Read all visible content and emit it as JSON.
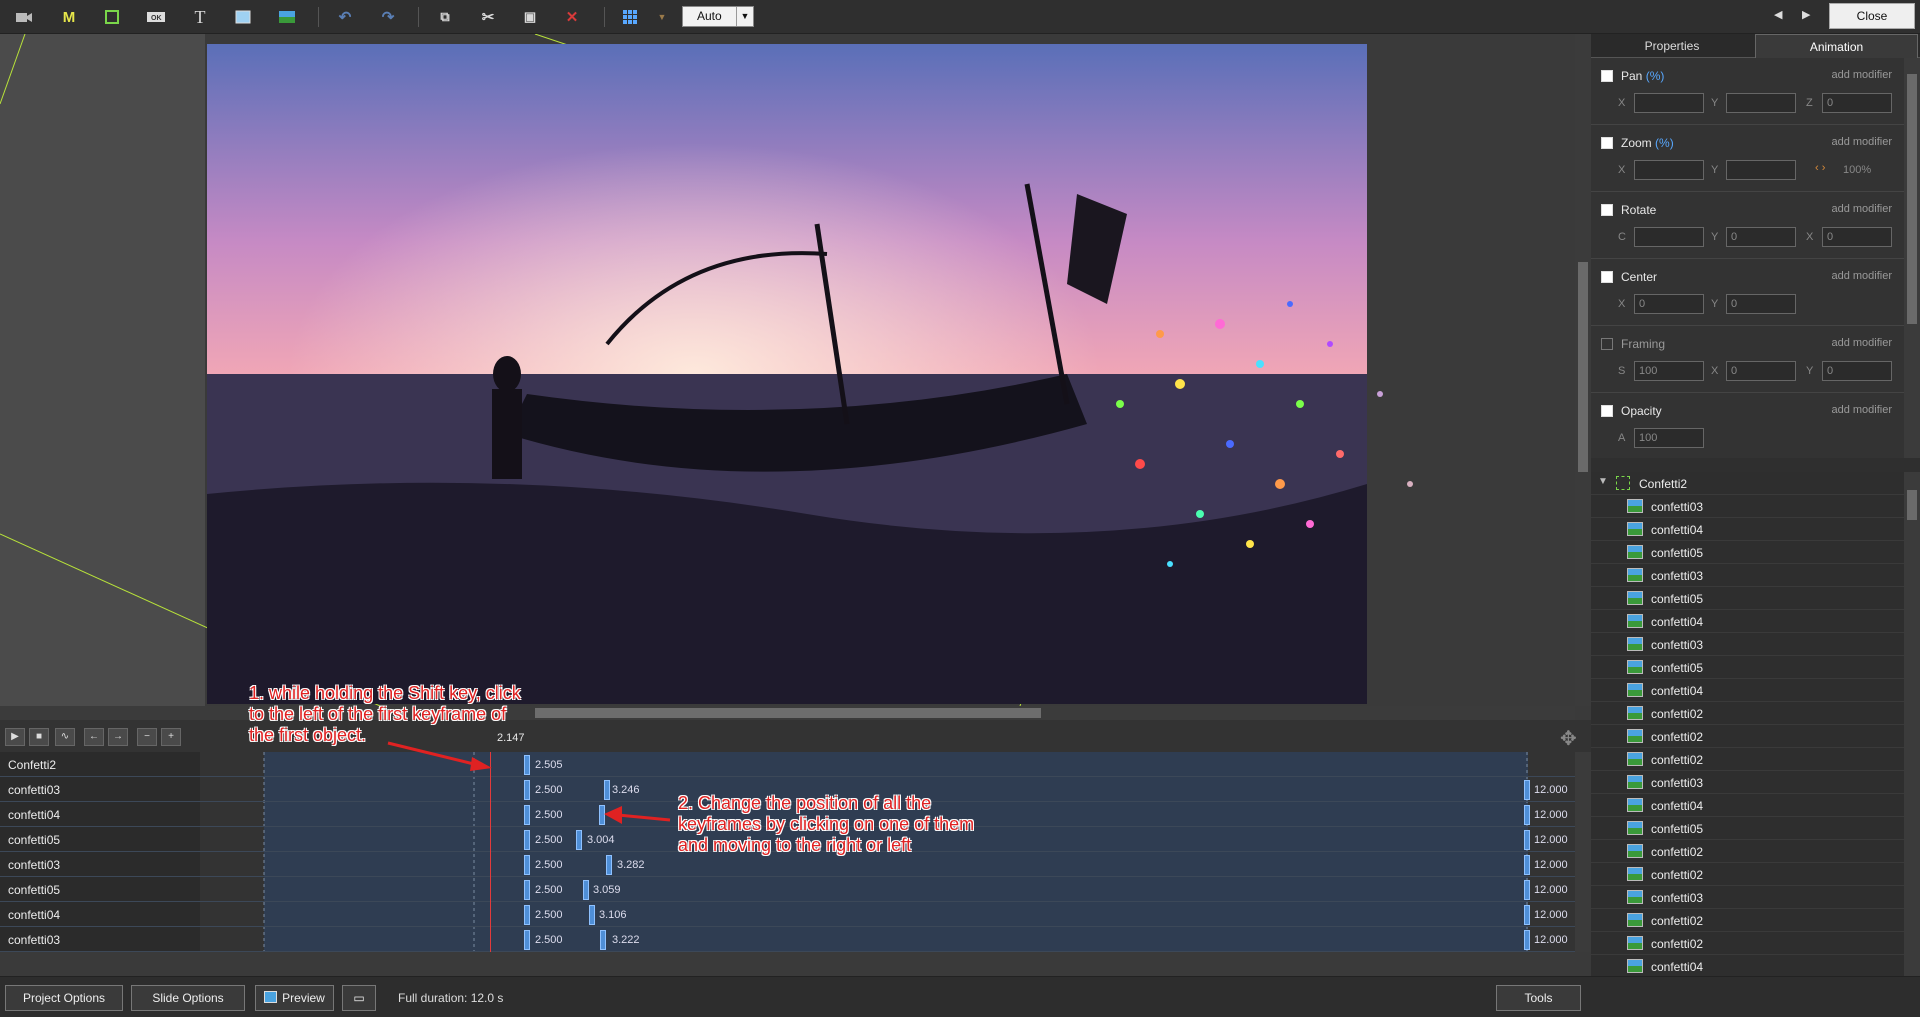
{
  "toolbar": {
    "zoom_mode": "Auto",
    "close_label": "Close",
    "icons": [
      "camera-icon",
      "m-icon",
      "frame-icon",
      "btn-icon",
      "text-icon",
      "rectangle-icon",
      "image-icon",
      "undo-icon",
      "redo-icon",
      "copy-icon",
      "cut-icon",
      "paste-icon",
      "delete-icon",
      "grid-icon",
      "dropdown-icon"
    ]
  },
  "timeline": {
    "current_time": "2.147",
    "rows": [
      {
        "name": "Confetti2",
        "k1": "2.505",
        "k2": "",
        "end": ""
      },
      {
        "name": "confetti03",
        "k1": "2.500",
        "k2": "3.246",
        "end": "12.000"
      },
      {
        "name": "confetti04",
        "k1": "2.500",
        "k2": "",
        "end": "12.000"
      },
      {
        "name": "confetti05",
        "k1": "2.500",
        "k2": "3.004",
        "end": "12.000"
      },
      {
        "name": "confetti03",
        "k1": "2.500",
        "k2": "3.282",
        "end": "12.000"
      },
      {
        "name": "confetti05",
        "k1": "2.500",
        "k2": "3.059",
        "end": "12.000"
      },
      {
        "name": "confetti04",
        "k1": "2.500",
        "k2": "3.106",
        "end": "12.000"
      },
      {
        "name": "confetti03",
        "k1": "2.500",
        "k2": "3.222",
        "end": "12.000"
      }
    ]
  },
  "annotations": {
    "note1": [
      "1. while holding the Shift key, click",
      "to the left of the first keyframe of",
      "the first object."
    ],
    "note2": [
      "2. Change the position of all the",
      "keyframes by clicking on one of them",
      "and moving to the right or left"
    ]
  },
  "panel": {
    "tabs": [
      "Properties",
      "Animation"
    ],
    "active_tab": "Animation",
    "add_modifier": "add modifier",
    "groups": [
      {
        "title": "Pan",
        "pct": "(%)",
        "checked": true,
        "fields": [
          {
            "l": "X",
            "v": ""
          },
          {
            "l": "Y",
            "v": ""
          },
          {
            "l": "Z",
            "v": "0"
          }
        ]
      },
      {
        "title": "Zoom",
        "pct": "(%)",
        "checked": true,
        "fields": [
          {
            "l": "X",
            "v": ""
          },
          {
            "l": "Y",
            "v": ""
          }
        ],
        "extra": "100%"
      },
      {
        "title": "Rotate",
        "pct": "",
        "checked": true,
        "fields": [
          {
            "l": "C",
            "v": ""
          },
          {
            "l": "Y",
            "v": "0"
          },
          {
            "l": "X",
            "v": "0"
          }
        ]
      },
      {
        "title": "Center",
        "pct": "",
        "checked": true,
        "fields": [
          {
            "l": "X",
            "v": "0"
          },
          {
            "l": "Y",
            "v": "0"
          }
        ]
      },
      {
        "title": "Framing",
        "pct": "",
        "checked": false,
        "fields": [
          {
            "l": "S",
            "v": "100"
          },
          {
            "l": "X",
            "v": "0"
          },
          {
            "l": "Y",
            "v": "0"
          }
        ]
      },
      {
        "title": "Opacity",
        "pct": "",
        "checked": true,
        "fields": [
          {
            "l": "A",
            "v": "100"
          }
        ]
      }
    ],
    "objects": [
      "Confetti2",
      "confetti03",
      "confetti04",
      "confetti05",
      "confetti03",
      "confetti05",
      "confetti04",
      "confetti03",
      "confetti05",
      "confetti04",
      "confetti02",
      "confetti02",
      "confetti02",
      "confetti03",
      "confetti04",
      "confetti05",
      "confetti02",
      "confetti02",
      "confetti03",
      "confetti02",
      "confetti02",
      "confetti04"
    ]
  },
  "bottom": {
    "project_options": "Project Options",
    "slide_options": "Slide Options",
    "preview": "Preview",
    "full_duration": "Full duration: 12.0 s",
    "tools": "Tools"
  }
}
